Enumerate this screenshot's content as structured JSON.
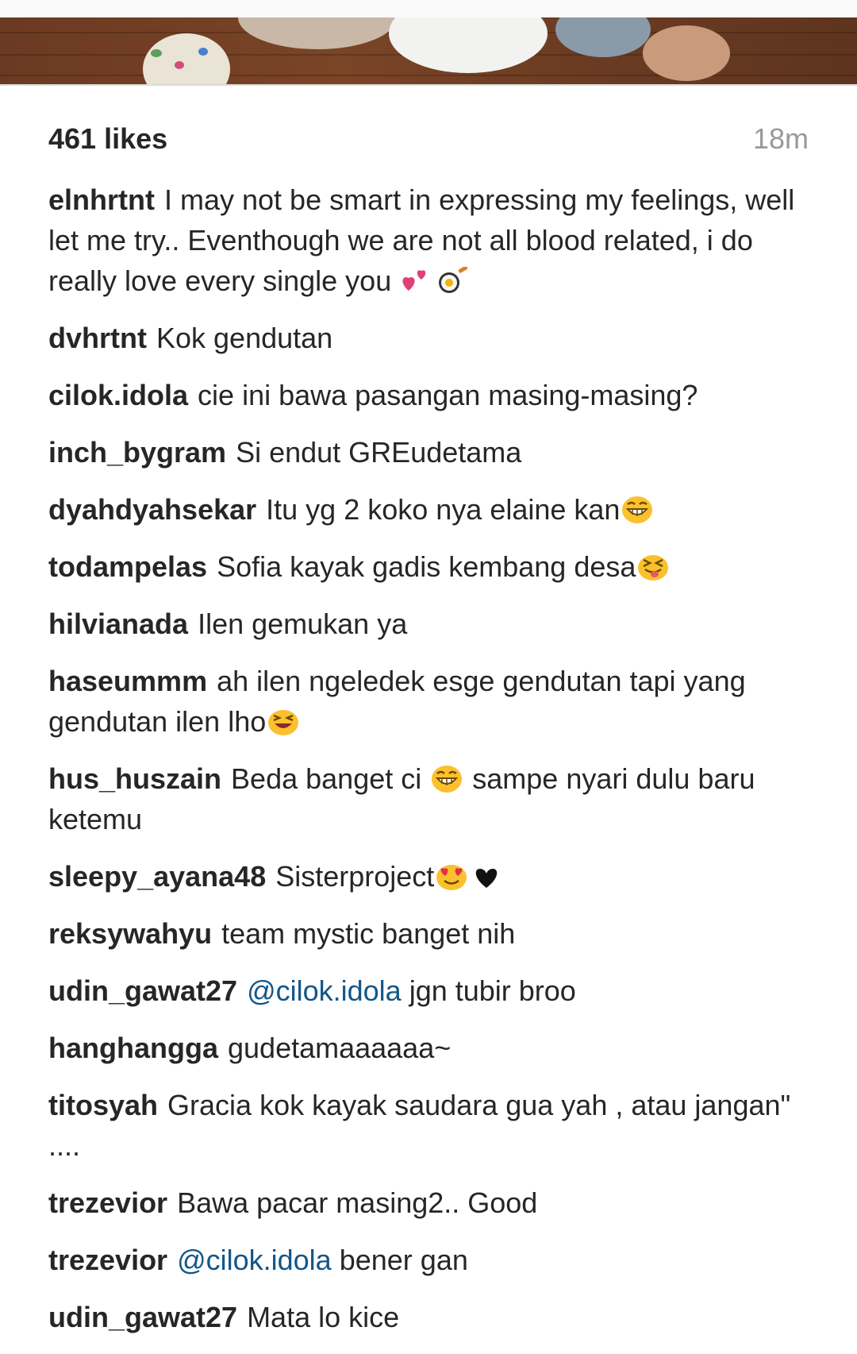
{
  "post": {
    "likes": "461 likes",
    "time": "18m"
  },
  "comments": [
    {
      "user": "elnhrtnt",
      "text": "I may not be smart in expressing my feelings, well let me try.. Eventhough we are not all blood related, i do really love every single you",
      "emoji_after": [
        "two-hearts",
        "cooking"
      ]
    },
    {
      "user": "dvhrtnt",
      "text": "Kok gendutan"
    },
    {
      "user": "cilok.idola",
      "text": "cie ini bawa pasangan masing-masing?"
    },
    {
      "user": "inch_bygram",
      "text": "Si endut GREudetama"
    },
    {
      "user": "dyahdyahsekar",
      "text": "Itu yg 2 koko nya elaine kan",
      "emoji_after": [
        "grinning-face"
      ]
    },
    {
      "user": "todampelas",
      "text": "Sofia kayak gadis kembang desa",
      "emoji_after": [
        "squinting-tongue-face"
      ]
    },
    {
      "user": "hilvianada",
      "text": "Ilen gemukan ya"
    },
    {
      "user": "haseummm",
      "text": "ah ilen ngeledek esge gendutan tapi yang gendutan ilen lho",
      "emoji_after": [
        "laughing-face"
      ]
    },
    {
      "user": "hus_huszain",
      "text_before": "Beda banget ci",
      "emoji_mid": "grinning-face",
      "text_after": "sampe nyari dulu baru ketemu"
    },
    {
      "user": "sleepy_ayana48",
      "text": "Sisterproject",
      "emoji_after": [
        "heart-eyes-face",
        "black-heart"
      ]
    },
    {
      "user": "reksywahyu",
      "text": "team mystic banget nih"
    },
    {
      "user": "udin_gawat27",
      "mention": "@cilok.idola",
      "text": "jgn tubir broo"
    },
    {
      "user": "hanghangga",
      "text": "gudetamaaaaaa~"
    },
    {
      "user": "titosyah",
      "text": "Gracia kok kayak saudara gua yah , atau jangan\" ...."
    },
    {
      "user": "trezevior",
      "text": "Bawa pacar masing2.. Good"
    },
    {
      "user": "trezevior",
      "mention": "@cilok.idola",
      "text": "bener gan"
    },
    {
      "user": "udin_gawat27",
      "text": "Mata lo kice"
    }
  ]
}
